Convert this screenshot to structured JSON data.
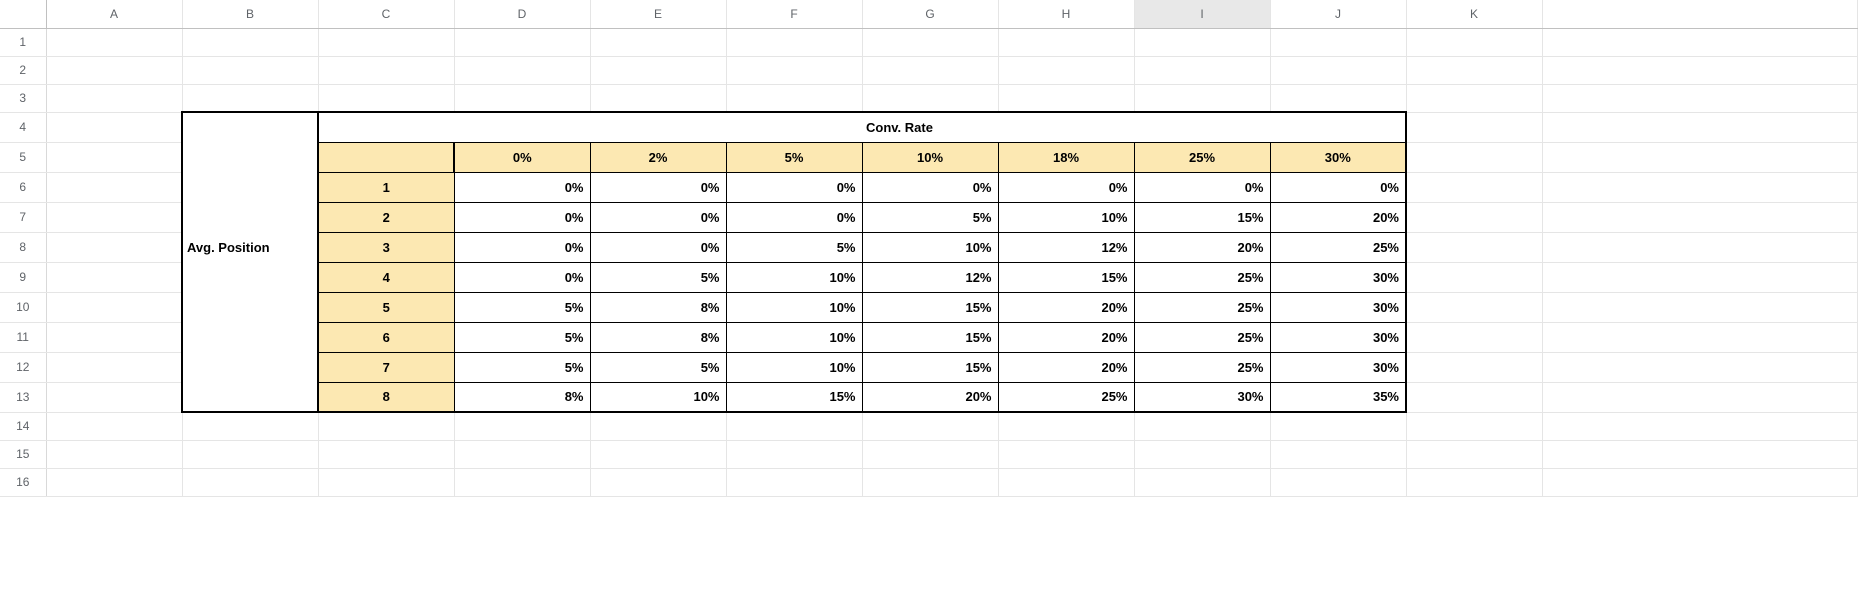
{
  "columns": [
    "A",
    "B",
    "C",
    "D",
    "E",
    "F",
    "G",
    "H",
    "I",
    "J",
    "K"
  ],
  "selected_column_index": 8,
  "row_count": 16,
  "labels": {
    "conv_rate": "Conv. Rate",
    "avg_position": "Avg. Position"
  },
  "chart_data": {
    "type": "table",
    "title": "Conv. Rate",
    "row_label": "Avg. Position",
    "col_headers": [
      "0%",
      "2%",
      "5%",
      "10%",
      "18%",
      "25%",
      "30%"
    ],
    "row_headers": [
      "1",
      "2",
      "3",
      "4",
      "5",
      "6",
      "7",
      "8"
    ],
    "rows": [
      [
        "0%",
        "0%",
        "0%",
        "0%",
        "0%",
        "0%",
        "0%"
      ],
      [
        "0%",
        "0%",
        "0%",
        "5%",
        "10%",
        "15%",
        "20%"
      ],
      [
        "0%",
        "0%",
        "5%",
        "10%",
        "12%",
        "20%",
        "25%"
      ],
      [
        "0%",
        "5%",
        "10%",
        "12%",
        "15%",
        "25%",
        "30%"
      ],
      [
        "5%",
        "8%",
        "10%",
        "15%",
        "20%",
        "25%",
        "30%"
      ],
      [
        "5%",
        "8%",
        "10%",
        "15%",
        "20%",
        "25%",
        "30%"
      ],
      [
        "5%",
        "5%",
        "10%",
        "15%",
        "20%",
        "25%",
        "30%"
      ],
      [
        "8%",
        "10%",
        "15%",
        "20%",
        "25%",
        "30%",
        "35%"
      ]
    ]
  },
  "colors": {
    "header_fill": "#fce8b2",
    "grid_line": "#e5e5e5"
  }
}
